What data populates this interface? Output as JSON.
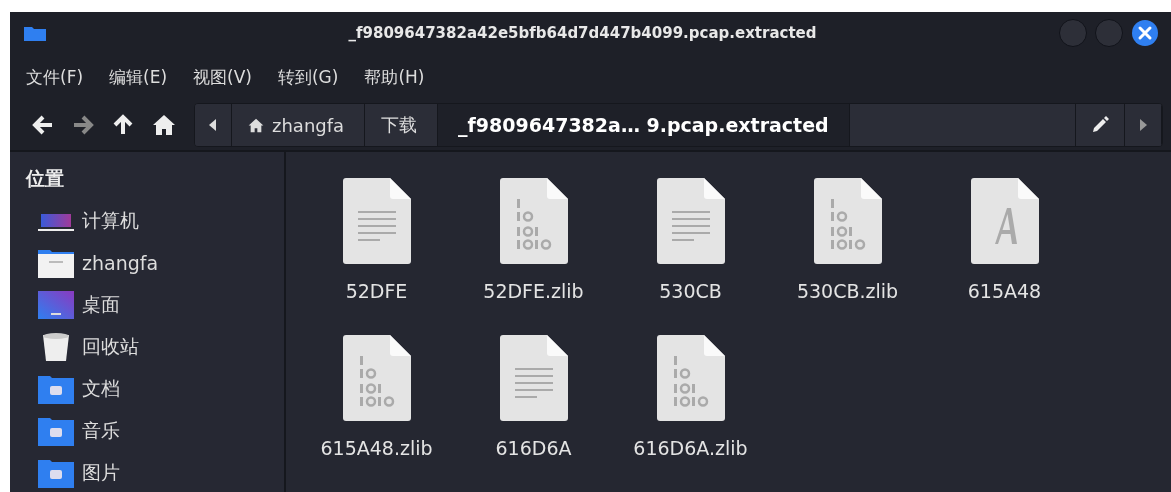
{
  "window": {
    "title": "_f9809647382a42e5bfb64d7d447b4099.pcap.extracted"
  },
  "menu": [
    "文件(F)",
    "编辑(E)",
    "视图(V)",
    "转到(G)",
    "帮助(H)"
  ],
  "path": [
    {
      "label": "zhangfa",
      "kind": "home",
      "selected": false
    },
    {
      "label": "下载",
      "kind": "folder",
      "selected": false
    },
    {
      "label": "_f9809647382a… 9.pcap.extracted",
      "kind": "folder",
      "selected": true
    }
  ],
  "sidebar": {
    "heading": "位置",
    "items": [
      {
        "label": "计算机",
        "kind": "computer"
      },
      {
        "label": "zhangfa",
        "kind": "home"
      },
      {
        "label": "桌面",
        "kind": "desktop"
      },
      {
        "label": "回收站",
        "kind": "trash"
      },
      {
        "label": "文档",
        "kind": "documents"
      },
      {
        "label": "音乐",
        "kind": "music"
      },
      {
        "label": "图片",
        "kind": "pictures"
      }
    ]
  },
  "files": [
    {
      "name": "52DFE",
      "kind": "text"
    },
    {
      "name": "52DFE.zlib",
      "kind": "binary"
    },
    {
      "name": "530CB",
      "kind": "text"
    },
    {
      "name": "530CB.zlib",
      "kind": "binary"
    },
    {
      "name": "615A48",
      "kind": "font"
    },
    {
      "name": "615A48.zlib",
      "kind": "binary"
    },
    {
      "name": "616D6A",
      "kind": "text"
    },
    {
      "name": "616D6A.zlib",
      "kind": "binary"
    }
  ]
}
